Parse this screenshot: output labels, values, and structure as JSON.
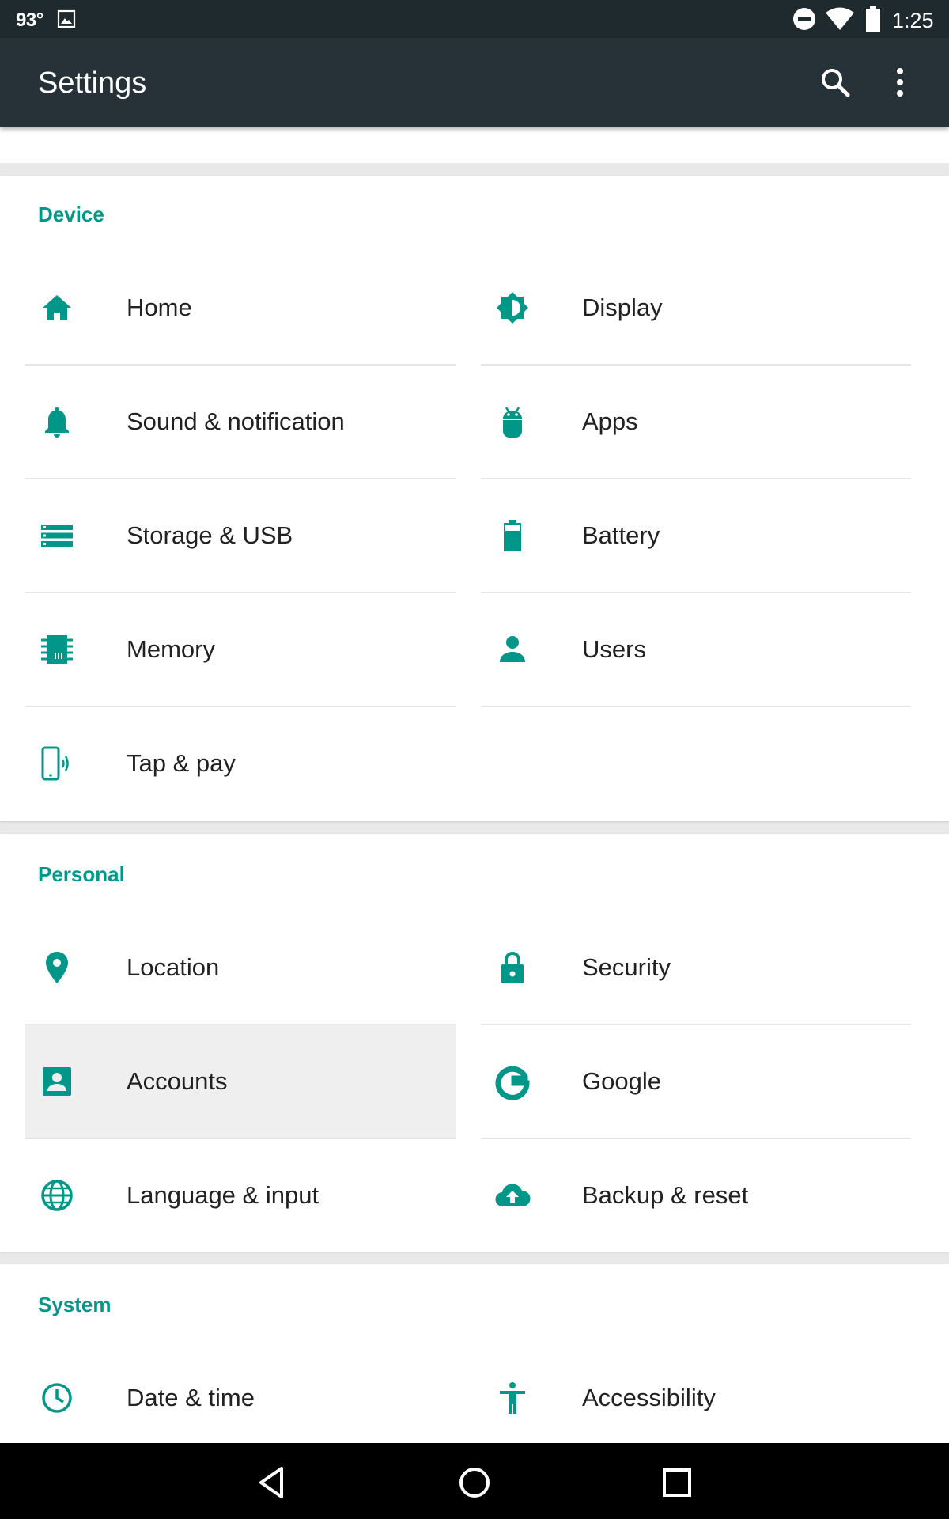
{
  "status_bar": {
    "temperature": "93°",
    "time": "1:25",
    "icons": [
      "image-icon",
      "do-not-disturb-icon",
      "wifi-icon",
      "battery-icon"
    ]
  },
  "app_bar": {
    "title": "Settings",
    "icons": [
      "search-icon",
      "more-vert-icon"
    ]
  },
  "accent_color": "#009688",
  "sections": {
    "device": {
      "title": "Device",
      "items": [
        {
          "label": "Home",
          "icon": "home-icon"
        },
        {
          "label": "Display",
          "icon": "brightness-icon"
        },
        {
          "label": "Sound & notification",
          "icon": "bell-icon"
        },
        {
          "label": "Apps",
          "icon": "android-icon"
        },
        {
          "label": "Storage & USB",
          "icon": "storage-icon"
        },
        {
          "label": "Battery",
          "icon": "battery-icon"
        },
        {
          "label": "Memory",
          "icon": "memory-chip-icon"
        },
        {
          "label": "Users",
          "icon": "person-icon"
        },
        {
          "label": "Tap & pay",
          "icon": "nfc-phone-icon"
        }
      ]
    },
    "personal": {
      "title": "Personal",
      "items": [
        {
          "label": "Location",
          "icon": "location-pin-icon"
        },
        {
          "label": "Security",
          "icon": "lock-icon"
        },
        {
          "label": "Accounts",
          "icon": "account-box-icon"
        },
        {
          "label": "Google",
          "icon": "google-g-icon"
        },
        {
          "label": "Language & input",
          "icon": "globe-icon"
        },
        {
          "label": "Backup & reset",
          "icon": "cloud-upload-icon"
        }
      ]
    },
    "system": {
      "title": "System",
      "items": [
        {
          "label": "Date & time",
          "icon": "clock-icon"
        },
        {
          "label": "Accessibility",
          "icon": "accessibility-icon"
        }
      ]
    }
  },
  "nav_bar": {
    "icons": [
      "back-icon",
      "home-circle-icon",
      "recents-icon"
    ]
  }
}
